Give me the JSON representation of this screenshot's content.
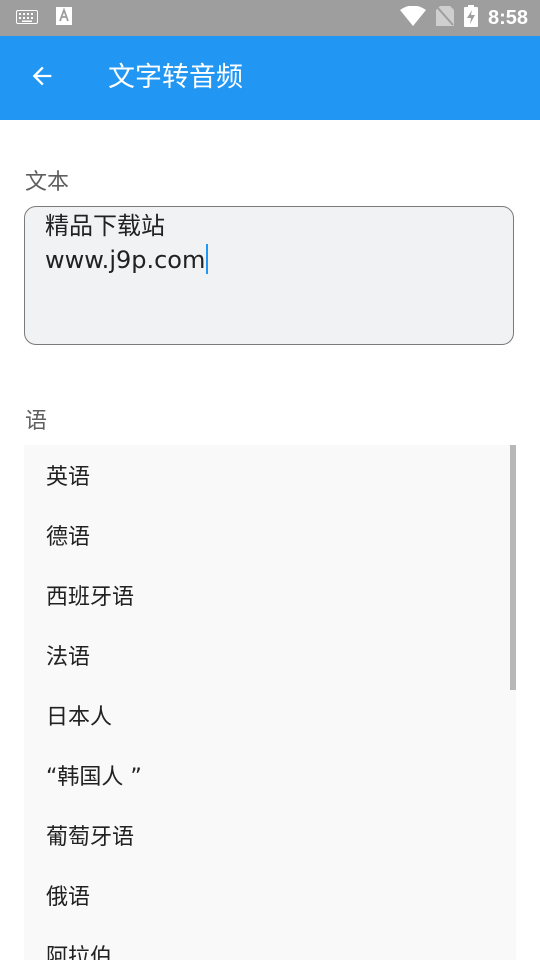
{
  "status_bar": {
    "time": "8:58",
    "icons": [
      "keyboard-icon",
      "text-input-icon",
      "wifi-icon",
      "no-sim-icon",
      "battery-charging-icon"
    ]
  },
  "app_bar": {
    "title": "文字转音频"
  },
  "form": {
    "text_label": "文本",
    "text_line1": "精品下载站",
    "text_line2": "www.j9p.com",
    "language_label": "语"
  },
  "languages": [
    "英语",
    "德语",
    "西班牙语",
    "法语",
    "日本人",
    "“韩国人 ”",
    "葡萄牙语",
    "俄语",
    "阿拉伯"
  ],
  "colors": {
    "app_bar": "#2196f3",
    "status_bar": "#9e9e9e",
    "caret": "#2196f3"
  }
}
